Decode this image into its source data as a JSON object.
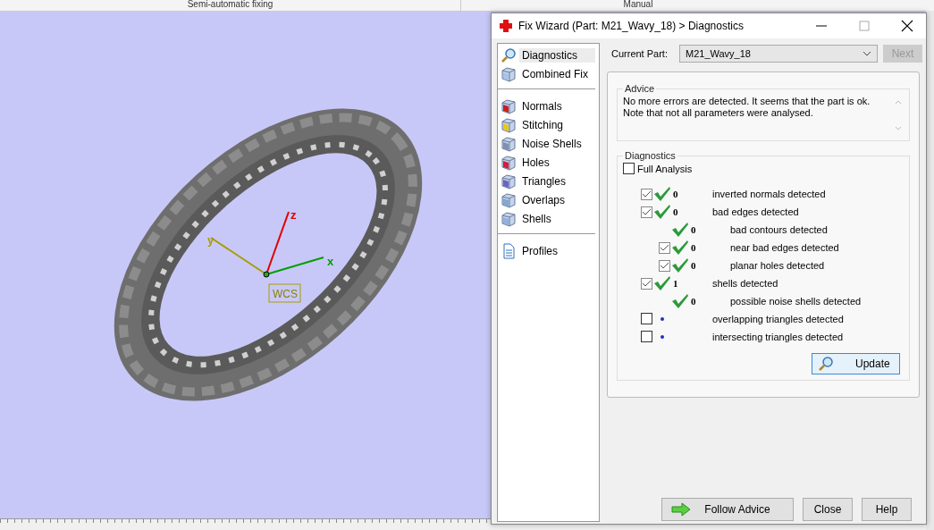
{
  "header": {
    "columns": [
      "Semi-automatic fixing",
      "Manual"
    ]
  },
  "viewport": {
    "axes": [
      {
        "label": "x",
        "color": "#00a000"
      },
      {
        "label": "y",
        "color": "#a89c00"
      },
      {
        "label": "z",
        "color": "#e00000"
      }
    ],
    "origin_label": "WCS"
  },
  "window": {
    "title": "Fix Wizard (Part: M21_Wavy_18) > Diagnostics"
  },
  "sidebar": {
    "groups": [
      [
        {
          "label": "Diagnostics",
          "selected": true
        },
        {
          "label": "Combined Fix",
          "selected": false
        }
      ],
      [
        {
          "label": "Normals",
          "selected": false
        },
        {
          "label": "Stitching",
          "selected": false
        },
        {
          "label": "Noise Shells",
          "selected": false
        },
        {
          "label": "Holes",
          "selected": false
        },
        {
          "label": "Triangles",
          "selected": false
        },
        {
          "label": "Overlaps",
          "selected": false
        },
        {
          "label": "Shells",
          "selected": false
        }
      ],
      [
        {
          "label": "Profiles",
          "selected": false
        }
      ]
    ]
  },
  "current_part": {
    "label": "Current Part:",
    "value": "M21_Wavy_18",
    "next_button": {
      "label": "Next",
      "disabled": true
    }
  },
  "advice": {
    "title": "Advice",
    "text": "No more errors are detected. It seems that the part is ok.\nNote that not all parameters were analysed."
  },
  "diagnostics": {
    "title": "Diagnostics",
    "full_analysis": {
      "label": "Full Analysis",
      "checked": false
    },
    "items": [
      {
        "checked": true,
        "done": true,
        "count": "0",
        "label": "inverted normals detected"
      },
      {
        "checked": true,
        "done": true,
        "count": "0",
        "label": "bad edges detected",
        "children": [
          {
            "done": true,
            "count": "0",
            "label": "bad contours detected"
          },
          {
            "checked": true,
            "done": true,
            "count": "0",
            "label": "near bad edges detected"
          },
          {
            "checked": true,
            "done": true,
            "count": "0",
            "label": "planar holes detected"
          }
        ]
      },
      {
        "checked": true,
        "done": true,
        "count": "1",
        "label": "shells detected",
        "children": [
          {
            "done": true,
            "count": "0",
            "label": "possible noise shells detected"
          }
        ]
      },
      {
        "checked": false,
        "done": false,
        "label": "overlapping triangles detected"
      },
      {
        "checked": false,
        "done": false,
        "label": "intersecting triangles detected"
      }
    ],
    "update_button": "Update"
  },
  "buttons": [
    {
      "label": "Follow Advice",
      "kind": "arrow"
    },
    {
      "label": "Close",
      "kind": "plain"
    },
    {
      "label": "Help",
      "kind": "plain"
    }
  ]
}
